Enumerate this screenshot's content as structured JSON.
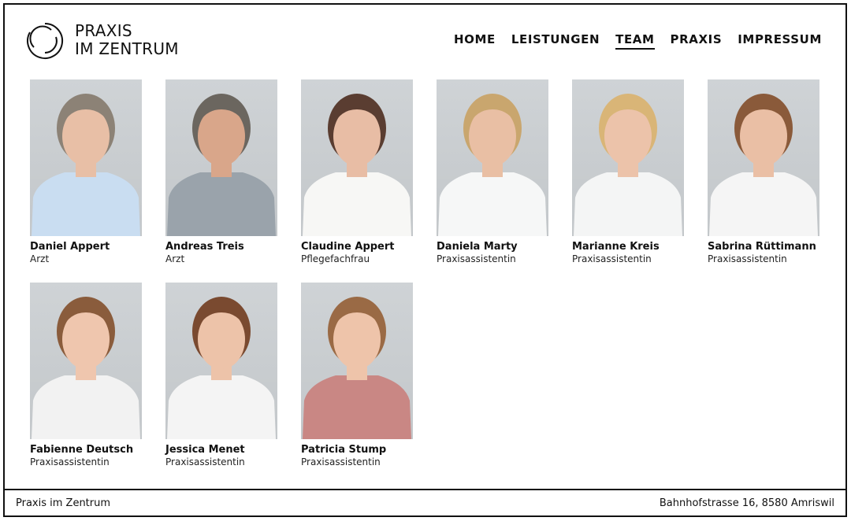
{
  "brand": {
    "line1": "PRAXIS",
    "line2": "IM ZENTRUM",
    "icon": "circle-logo-icon"
  },
  "nav": [
    {
      "label": "HOME",
      "active": false
    },
    {
      "label": "LEISTUNGEN",
      "active": false
    },
    {
      "label": "TEAM",
      "active": true
    },
    {
      "label": "PRAXIS",
      "active": false
    },
    {
      "label": "IMPRESSUM",
      "active": false
    }
  ],
  "team": [
    {
      "name": "Daniel Appert",
      "role": "Arzt",
      "shirt": "#c9ddf1",
      "hair": "#8c8276",
      "skin": "#e8bfa6"
    },
    {
      "name": "Andreas Treis",
      "role": "Arzt",
      "shirt": "#9aa3ab",
      "hair": "#6b665f",
      "skin": "#d9a68a"
    },
    {
      "name": "Claudine Appert",
      "role": "Pflegefachfrau",
      "shirt": "#f7f7f5",
      "hair": "#5a3d31",
      "skin": "#e8bda5"
    },
    {
      "name": "Daniela Marty",
      "role": "Praxisassistentin",
      "shirt": "#f6f7f7",
      "hair": "#c9a66e",
      "skin": "#e9bfa4"
    },
    {
      "name": "Marianne Kreis",
      "role": "Praxisassistentin",
      "shirt": "#f4f5f5",
      "hair": "#d9b577",
      "skin": "#ecc3aa"
    },
    {
      "name": "Sabrina Rüttimann",
      "role": "Praxisassistentin",
      "shirt": "#f5f5f5",
      "hair": "#8a5a3a",
      "skin": "#eabfa5"
    },
    {
      "name": "Fabienne Deutsch",
      "role": "Praxisassistentin",
      "shirt": "#f2f2f2",
      "hair": "#8a5c3c",
      "skin": "#efc6ae"
    },
    {
      "name": "Jessica Menet",
      "role": "Praxisassistentin",
      "shirt": "#f4f4f4",
      "hair": "#7a4a30",
      "skin": "#edc3a9"
    },
    {
      "name": "Patricia Stump",
      "role": "Praxisassistentin",
      "shirt": "#c98784",
      "hair": "#9a6a45",
      "skin": "#eec4aa"
    }
  ],
  "footer": {
    "left": "Praxis im Zentrum",
    "right": "Bahnhofstrasse 16, 8580 Amriswil"
  }
}
